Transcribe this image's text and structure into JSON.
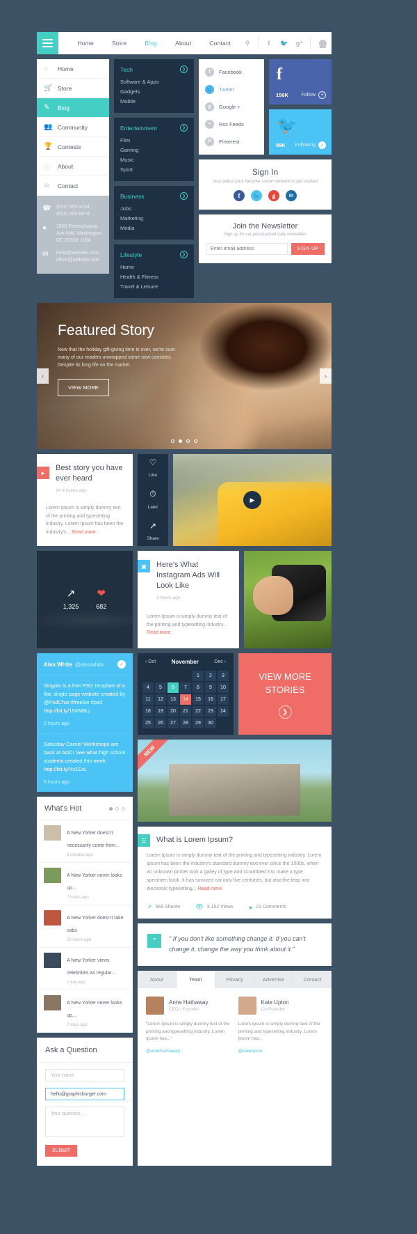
{
  "topnav": {
    "menu_icon": "hamburger-icon",
    "links": [
      {
        "label": "Home",
        "active": false
      },
      {
        "label": "Store",
        "active": false
      },
      {
        "label": "Blog",
        "active": true
      },
      {
        "label": "About",
        "active": false
      },
      {
        "label": "Contact",
        "active": false
      }
    ],
    "search_icon": "search-icon",
    "social": [
      "f",
      "t",
      "g+"
    ],
    "account_icon": "user-avatar-icon"
  },
  "sidebar": {
    "items": [
      {
        "label": "Home",
        "icon": "home-icon",
        "active": false
      },
      {
        "label": "Store",
        "icon": "cart-icon",
        "active": false
      },
      {
        "label": "Blog",
        "icon": "pencil-icon",
        "active": true
      },
      {
        "label": "Community",
        "icon": "people-icon",
        "active": false
      },
      {
        "label": "Contests",
        "icon": "trophy-icon",
        "active": false
      },
      {
        "label": "About",
        "icon": "info-icon",
        "active": false
      },
      {
        "label": "Contact",
        "icon": "envelope-icon",
        "active": false
      }
    ],
    "contact": {
      "phone_icon": "phone-icon",
      "phone": "(912) 555-1234\n(912) 555-5678",
      "location_icon": "map-pin-icon",
      "address": "1600 Pennsylvania\nAve NW, Washington\nDC 20500, USA",
      "mail_icon": "envelope-icon",
      "email": "hello@website.com\noffice@website.com"
    }
  },
  "submenus": [
    {
      "title": "Tech",
      "items": [
        "Software & Apps",
        "Gadgets",
        "Mobile"
      ]
    },
    {
      "title": "Entertainment",
      "items": [
        "Film",
        "Gaming",
        "Music",
        "Sport"
      ]
    },
    {
      "title": "Business",
      "items": [
        "Jobs",
        "Marketing",
        "Media"
      ]
    },
    {
      "title": "Lifestyle",
      "items": [
        "Home",
        "Health & Fitness",
        "Travel & Leisure"
      ]
    }
  ],
  "social_list": [
    {
      "label": "Facebook",
      "glyph": "f",
      "active": false
    },
    {
      "label": "Twitter",
      "glyph": "t",
      "active": true
    },
    {
      "label": "Google +",
      "glyph": "g",
      "active": false
    },
    {
      "label": "Rss Feeds",
      "glyph": "◔",
      "active": false
    },
    {
      "label": "Pinterest",
      "glyph": "P",
      "active": false
    }
  ],
  "follow_tiles": [
    {
      "network": "facebook",
      "glyph": "f",
      "count": "156K",
      "action": "Follow",
      "color": "#4a64ab"
    },
    {
      "network": "twitter",
      "glyph": "ᵗ",
      "count": "89K",
      "action": "Following",
      "color": "#4cc3f5"
    }
  ],
  "signin": {
    "title": "Sign In",
    "subtitle": "Just select your favorite social network to get started",
    "buttons": [
      {
        "name": "facebook",
        "glyph": "f",
        "color": "#3b5a9a"
      },
      {
        "name": "twitter",
        "glyph": "t",
        "color": "#4cc3f5"
      },
      {
        "name": "googleplus",
        "glyph": "g",
        "color": "#e8483c"
      },
      {
        "name": "linkedin",
        "glyph": "in",
        "color": "#1b6fa8"
      }
    ]
  },
  "newsletter": {
    "title": "Join the Newsletter",
    "subtitle": "Sign up for our personalized daily newsletter",
    "placeholder": "Enter email address",
    "button": "SIGN UP"
  },
  "featured": {
    "title": "Featured Story",
    "text": "Now that the holiday gift-giving time is over, we're sure many of our readers unwrapped some new consoles. Despite its long life on the market.",
    "button": "VIEW MORE",
    "prev": "‹",
    "next": "›",
    "dots": 4,
    "active_dot": 2
  },
  "story_video": {
    "badge_icon": "video-icon",
    "title": "Best story you have ever heard",
    "time": "24 minutes ago",
    "body": "Lorem Ipsum is simply dummy text of the printing and typesetting industry. Lorem Ipsum has been the industry's...",
    "read_more": "Read more",
    "actions": [
      {
        "label": "Like",
        "icon": "heart-outline-icon",
        "glyph": "♡"
      },
      {
        "label": "Later",
        "icon": "clock-icon",
        "glyph": "◴"
      },
      {
        "label": "Share",
        "icon": "share-icon",
        "glyph": "↱"
      }
    ],
    "play_icon": "play-icon"
  },
  "stats": {
    "shares": {
      "icon": "share-icon",
      "value": "1,325"
    },
    "likes": {
      "icon": "heart-filled-icon",
      "value": "682"
    }
  },
  "instagram_story": {
    "badge_icon": "camera-icon",
    "title": "Here's What Instagram Ads Will Look Like",
    "time": "3 hours ago",
    "body": "Lorem Ipsum is simply dummy text of the printing and typesetting industry...",
    "read_more": "Read more"
  },
  "tweets": {
    "name": "Alex White",
    "handle": "@alexwhite",
    "verified_icon": "check-icon",
    "items": [
      {
        "text": "Singolo is a free PSD template of a flat, single page website created by @PsdChat #freebie #psd http://bit.ly/19XM8Lj",
        "bold": "#psd http://bit.ly/19XM8Lj",
        "age": "2 hours ago"
      },
      {
        "text": "Saturday Career Workshops are back at ADC! See what high school students created this week: http://bit.ly/Xx1EsL",
        "bold": "http://bit.ly/Xx1EsL",
        "age": "6 hours ago"
      }
    ]
  },
  "calendar": {
    "prev": "‹ Oct",
    "month": "November",
    "next": "Dec ›",
    "weeks": [
      [
        "",
        "",
        "",
        "",
        "1",
        "2",
        "3"
      ],
      [
        "4",
        "5",
        "6",
        "7",
        "8",
        "9",
        "10"
      ],
      [
        "11",
        "12",
        "13",
        "14",
        "15",
        "16",
        "17"
      ],
      [
        "18",
        "19",
        "20",
        "21",
        "22",
        "23",
        "24"
      ],
      [
        "25",
        "26",
        "27",
        "28",
        "29",
        "30",
        ""
      ]
    ],
    "teal_day": "6",
    "red_day": "14"
  },
  "view_more_stories": {
    "title": "VIEW MORE STORIES",
    "arrow_icon": "arrow-right-icon"
  },
  "new_photo": {
    "ribbon": "NEW"
  },
  "lorem_card": {
    "badge_icon": "document-icon",
    "title": "What is Lorem Ipsum?",
    "body": "Lorem Ipsum is simply dummy text of the printing and typesetting industry. Lorem Ipsum has been the industry's standard dummy text ever since the 1500s, when an unknown printer took a galley of type and scrambled it to make a type specimen book. It has survived not only five centuries, but also the leap into electronic typesetting...",
    "read_more": "Read more",
    "meta": [
      {
        "icon": "share-icon",
        "value": "569 Shares"
      },
      {
        "icon": "eye-icon",
        "value": "3,152 Views"
      },
      {
        "icon": "comment-icon",
        "value": "21 Comments"
      }
    ]
  },
  "whats_hot": {
    "title": "What's Hot",
    "dots": 3,
    "items": [
      {
        "text": "A New Yorker doesn't necessarily come from...",
        "age": "3 minutes ago",
        "thumb": "#cbbfa8"
      },
      {
        "text": "A New Yorker never looks up...",
        "age": "7 hours ago",
        "thumb": "#7c9a5c"
      },
      {
        "text": "A New Yorker doesn't take cabs",
        "age": "23 hours ago",
        "thumb": "#c0563f"
      },
      {
        "text": "A New Yorker views celebrities as regular...",
        "age": "1 day ago",
        "thumb": "#3b4a5c"
      },
      {
        "text": "A New Yorker never looks up...",
        "age": "2 days ago",
        "thumb": "#8a7662"
      }
    ]
  },
  "quote": {
    "mark_icon": "quote-icon",
    "text": "\" If you don't like something change it. If you can't change it, change the way you think about it \""
  },
  "ask": {
    "title": "Ask a Question",
    "name_placeholder": "Your name",
    "email_value": "hello@graphicburger.com",
    "question_placeholder": "Your question...",
    "submit": "SUBMIT"
  },
  "team": {
    "tabs": [
      {
        "label": "About",
        "active": false
      },
      {
        "label": "Team",
        "active": true
      },
      {
        "label": "Privacy",
        "active": false
      },
      {
        "label": "Advertise",
        "active": false
      },
      {
        "label": "Contact",
        "active": false
      }
    ],
    "people": [
      {
        "name": "Anne Hathaway",
        "role": "CEO / Founder",
        "body": "\"Lorem Ipsum is simply dummy text of the printing and typesetting industry. Lorem Ipsum has...\"",
        "handle": "@annehathaway",
        "avatar": "#b4825f"
      },
      {
        "name": "Kate Upton",
        "role": "Co-Founder",
        "body": "Lorem Ipsum is simply dummy text of the printing and typesetting industry. Lorem Ipsum has...",
        "handle": "@kateupton",
        "avatar": "#d2a98a"
      }
    ]
  }
}
